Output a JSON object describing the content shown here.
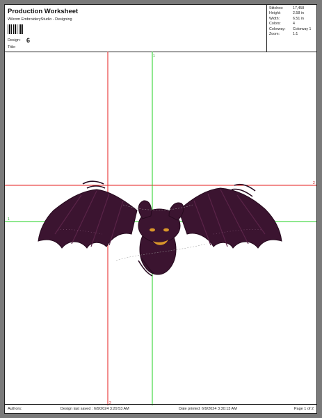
{
  "header": {
    "title": "Production Worksheet",
    "subtitle": "Wilcom EmbroideryStudio - Designing",
    "design_label": "Design:",
    "design_value": "6",
    "title_label": "Title:"
  },
  "stats": [
    {
      "label": "Stitches:",
      "value": "17,458"
    },
    {
      "label": "Height:",
      "value": "2.58 in"
    },
    {
      "label": "Width:",
      "value": "6.51 in"
    },
    {
      "label": "Colors:",
      "value": "4"
    },
    {
      "label": "Colorway:",
      "value": "Colorway 1"
    },
    {
      "label": "Zoom:",
      "value": "1:1"
    }
  ],
  "guides": {
    "top_marker": "1",
    "bottom_marker": "2",
    "left_marker": "1",
    "right_marker": "2"
  },
  "footer": {
    "authors": "Authors:",
    "last_saved": "Design last saved : 6/9/2024 3:29:53 AM",
    "printed": "Date printed: 6/9/2024 3:30:13 AM",
    "page": "Page 1 of 2"
  },
  "colors": {
    "bat_body": "#3b1430",
    "bat_highlight": "#5a2348",
    "eyes": "#d9962a",
    "guide_red": "#e41b1b",
    "guide_green": "#22d022"
  }
}
